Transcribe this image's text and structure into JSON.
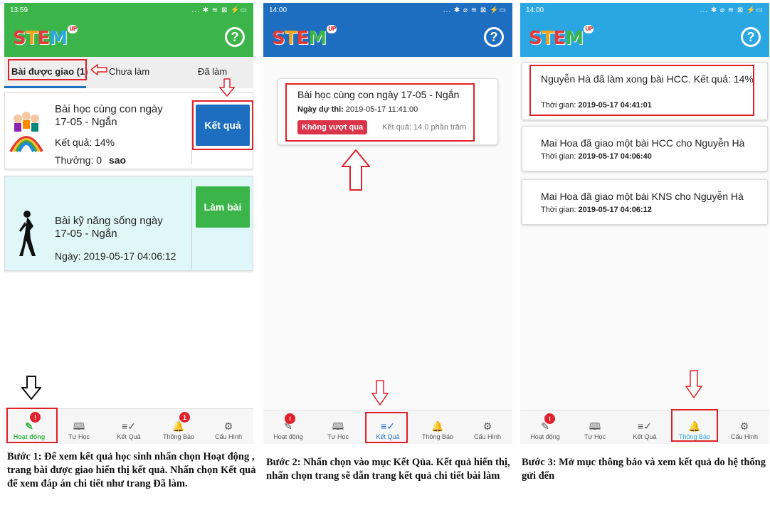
{
  "brand": {
    "logo_text": "STEM",
    "logo_badge": "UP",
    "help_symbol": "?",
    "colors": {
      "green": "#3bb54a",
      "blue": "#1d6ec0",
      "sky": "#2aa7e3",
      "red": "#e0202a",
      "highlight": "#e0202a"
    }
  },
  "screen1": {
    "status_time": "13:59",
    "status_icons": "... ✱ ≋ ⊠ ⚡▭",
    "tabs": [
      "Bài được giao (1)",
      "Chưa làm",
      "Đã làm"
    ],
    "card1": {
      "title": "Bài học cùng con ngày 17-05 - Ngắn",
      "result": "Kết quả: 14%",
      "reward": "Thưởng: 0",
      "reward_unit": "sao",
      "button": "Kết quả"
    },
    "card2": {
      "title": "Bài kỹ năng sống ngày 17-05 - Ngắn",
      "date": "Ngày: 2019-05-17 04:06:12",
      "button": "Làm bài"
    },
    "nav": [
      {
        "label": "Hoạt động",
        "icon": "activity-icon",
        "badge": "!"
      },
      {
        "label": "Tự Học",
        "icon": "book-icon"
      },
      {
        "label": "Kết Quả",
        "icon": "result-list-icon"
      },
      {
        "label": "Thông Báo",
        "icon": "bell-icon",
        "badge": "1"
      },
      {
        "label": "Cấu Hình",
        "icon": "gear-icon"
      }
    ]
  },
  "screen2": {
    "status_time": "14:00",
    "status_icons": "... ✱ ⌀ ≋ ⊠ ⚡▭",
    "card": {
      "title": "Bài học cùng con ngày 17-05 - Ngắn",
      "exam_date_label": "Ngày dự thi:",
      "exam_date": "2019-05-17 11:41:00",
      "status": "Không vượt qua",
      "result": "Kết quả: 14.0 phần trăm"
    },
    "nav": [
      {
        "label": "Hoạt động",
        "icon": "activity-icon",
        "badge": "!"
      },
      {
        "label": "Tự Học",
        "icon": "book-icon"
      },
      {
        "label": "Kết Quả",
        "icon": "result-list-icon"
      },
      {
        "label": "Thông Báo",
        "icon": "bell-icon"
      },
      {
        "label": "Cấu Hình",
        "icon": "gear-icon"
      }
    ]
  },
  "screen3": {
    "status_time": "14:00",
    "status_icons": "... ✱ ⌀ ≋ ⊠ ⚡▭",
    "notifications": [
      {
        "message": "Nguyễn Hà đã làm xong bài HCC. Kết quả: 14%",
        "time_label": "Thời gian:",
        "time": "2019-05-17 04:41:01"
      },
      {
        "message": "Mai Hoa đã giao một bài HCC cho Nguyễn Hà",
        "time_label": "Thời gian:",
        "time": "2019-05-17 04:06:40"
      },
      {
        "message": "Mai Hoa đã giao một bài KNS cho Nguyễn Hà",
        "time_label": "Thời gian:",
        "time": "2019-05-17 04:06:12"
      }
    ],
    "nav": [
      {
        "label": "Hoạt động",
        "icon": "activity-icon",
        "badge": "!"
      },
      {
        "label": "Tự Học",
        "icon": "book-icon"
      },
      {
        "label": "Kết Quả",
        "icon": "result-list-icon"
      },
      {
        "label": "Thông Báo",
        "icon": "bell-icon"
      },
      {
        "label": "Cấu Hình",
        "icon": "gear-icon"
      }
    ]
  },
  "captions": {
    "step1": "Bước 1: Để xem kết quả học sinh nhấn chọn Hoạt động , trang bài được giao hiển thị kết quả. Nhấn chọn Kết quả để xem đáp án chi tiết như trang Đã làm.",
    "step2": "Bước 2: Nhấn chọn vào mục Kết Qủa. Kết quả hiển thị, nhấn chọn trang sẽ dẫn trang kết quả chi tiết bài làm",
    "step3": "Bước 3: Mở mục thông báo và xem kết quả do hệ thống gửi đến"
  }
}
